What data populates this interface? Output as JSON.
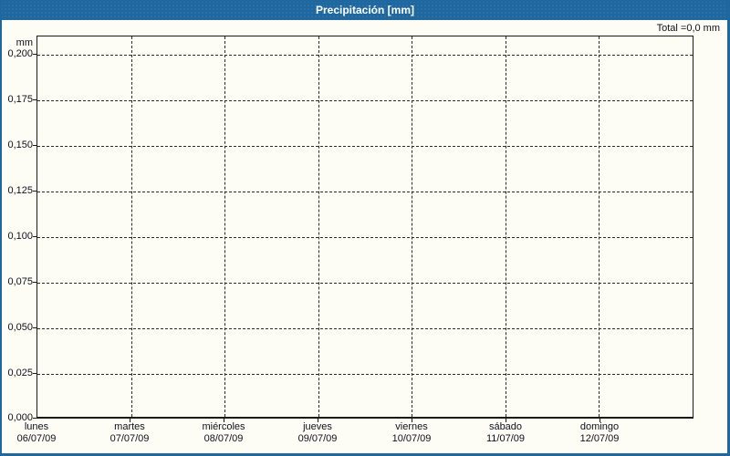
{
  "title": "Precipitación [mm]",
  "total_label": "Total =0,0 mm",
  "y_axis": {
    "unit": "mm",
    "ticks": [
      "0,200",
      "0,175",
      "0,150",
      "0,125",
      "0,100",
      "0,075",
      "0,050",
      "0,025",
      "0,000"
    ]
  },
  "x_axis": {
    "days": [
      {
        "day": "lunes",
        "date": "06/07/09"
      },
      {
        "day": "martes",
        "date": "07/07/09"
      },
      {
        "day": "miércoles",
        "date": "08/07/09"
      },
      {
        "day": "jueves",
        "date": "09/07/09"
      },
      {
        "day": "viernes",
        "date": "10/07/09"
      },
      {
        "day": "sábado",
        "date": "11/07/09"
      },
      {
        "day": "domingo",
        "date": "12/07/09"
      }
    ]
  },
  "colors": {
    "titlebar": "#1e689f",
    "frame": "#1e689f",
    "background": "#fdfdf6",
    "grid": "#2a2a2a",
    "text": "#10101c",
    "title_text": "#ffffff"
  },
  "chart_data": {
    "type": "bar",
    "title": "Precipitación [mm]",
    "xlabel": "",
    "ylabel": "mm",
    "categories": [
      "lunes 06/07/09",
      "martes 07/07/09",
      "miércoles 08/07/09",
      "jueves 09/07/09",
      "viernes 10/07/09",
      "sábado 11/07/09",
      "domingo 12/07/09"
    ],
    "values": [
      0,
      0,
      0,
      0,
      0,
      0,
      0
    ],
    "total": 0.0,
    "total_text": "Total =0,0 mm",
    "ylim": [
      0,
      0.21
    ],
    "ytick_step": 0.025,
    "ytick_labels": [
      "0,200",
      "0,175",
      "0,150",
      "0,125",
      "0,100",
      "0,075",
      "0,050",
      "0,025",
      "0,000"
    ],
    "grid": "dashed-both-axes",
    "legend": "none",
    "decimal_separator": ","
  }
}
